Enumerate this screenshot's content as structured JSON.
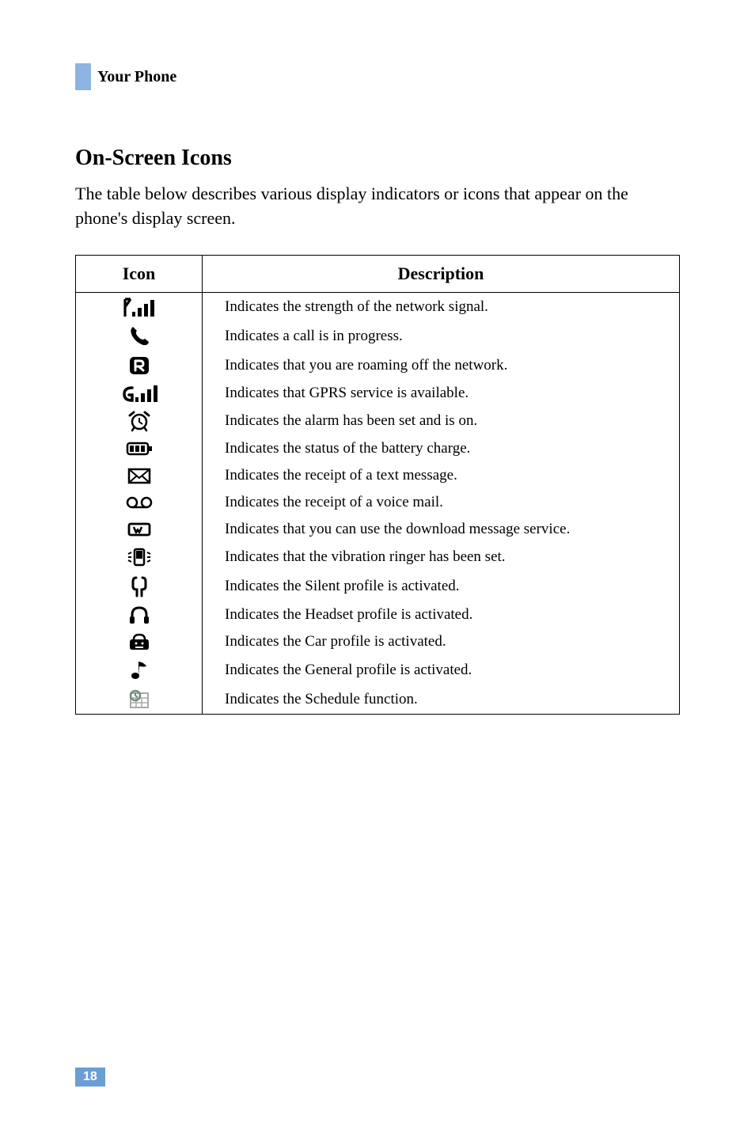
{
  "header": {
    "title": "Your Phone"
  },
  "section": {
    "title": "On-Screen Icons",
    "intro": "The table below describes various display indicators or icons that appear on the phone's display screen."
  },
  "table": {
    "head_icon": "Icon",
    "head_desc": "Description",
    "rows": [
      {
        "icon_name": "signal-strength-icon",
        "desc": "Indicates the strength of the network signal."
      },
      {
        "icon_name": "call-in-progress-icon",
        "desc": "Indicates a call is in progress."
      },
      {
        "icon_name": "roaming-icon",
        "desc": "Indicates that you are roaming off the network."
      },
      {
        "icon_name": "gprs-icon",
        "desc": "Indicates that GPRS service is available."
      },
      {
        "icon_name": "alarm-icon",
        "desc": "Indicates the alarm has been set and is on."
      },
      {
        "icon_name": "battery-icon",
        "desc": "Indicates the status of the battery charge."
      },
      {
        "icon_name": "text-message-icon",
        "desc": "Indicates the receipt of a text message."
      },
      {
        "icon_name": "voice-mail-icon",
        "desc": "Indicates the receipt of a voice mail."
      },
      {
        "icon_name": "download-message-icon",
        "desc": "Indicates that you can use the download message service."
      },
      {
        "icon_name": "vibration-ringer-icon",
        "desc": "Indicates that the vibration ringer has been set."
      },
      {
        "icon_name": "silent-profile-icon",
        "desc": "Indicates the Silent profile is activated."
      },
      {
        "icon_name": "headset-profile-icon",
        "desc": "Indicates the Headset profile is activated."
      },
      {
        "icon_name": "car-profile-icon",
        "desc": "Indicates the Car profile is activated."
      },
      {
        "icon_name": "general-profile-icon",
        "desc": "Indicates the General profile is activated."
      },
      {
        "icon_name": "schedule-icon",
        "desc": "Indicates the Schedule function."
      }
    ]
  },
  "page_number": "18"
}
